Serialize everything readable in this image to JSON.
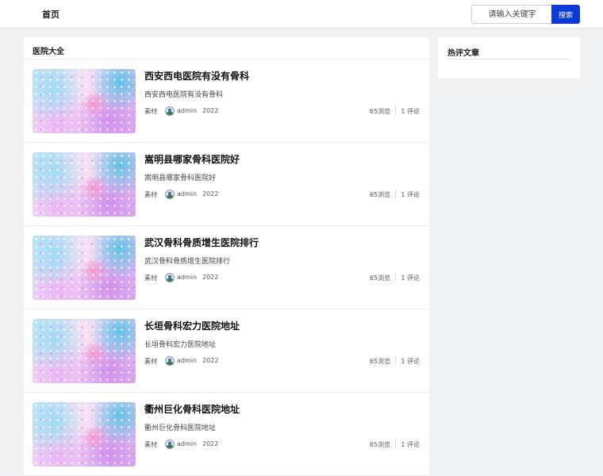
{
  "nav": {
    "home_label": "首页"
  },
  "search": {
    "placeholder": "请输入关键字",
    "button_label": "搜索"
  },
  "main": {
    "title": "医院大全",
    "articles": [
      {
        "title": "西安西电医院有没有骨科",
        "summary": "西安西电医院有没有骨科",
        "category": "素材",
        "author": "admin",
        "year": "2022",
        "views": "65浏览",
        "comments": "1 评论"
      },
      {
        "title": "嵩明县哪家骨科医院好",
        "summary": "嵩明县哪家骨科医院好",
        "category": "素材",
        "author": "admin",
        "year": "2022",
        "views": "65浏览",
        "comments": "1 评论"
      },
      {
        "title": "武汉骨科骨质增生医院排行",
        "summary": "武汉骨科骨质增生医院排行",
        "category": "素材",
        "author": "admin",
        "year": "2022",
        "views": "65浏览",
        "comments": "1 评论"
      },
      {
        "title": "长垣骨科宏力医院地址",
        "summary": "长垣骨科宏力医院地址",
        "category": "素材",
        "author": "admin",
        "year": "2022",
        "views": "65浏览",
        "comments": "1 评论"
      },
      {
        "title": "衢州巨化骨科医院地址",
        "summary": "衢州巨化骨科医院地址",
        "category": "素材",
        "author": "admin",
        "year": "2022",
        "views": "65浏览",
        "comments": "1 评论"
      }
    ]
  },
  "sidebar": {
    "title": "热评文章"
  },
  "colors": {
    "accent": "#0c3bd8",
    "background": "#f0f1f3"
  }
}
